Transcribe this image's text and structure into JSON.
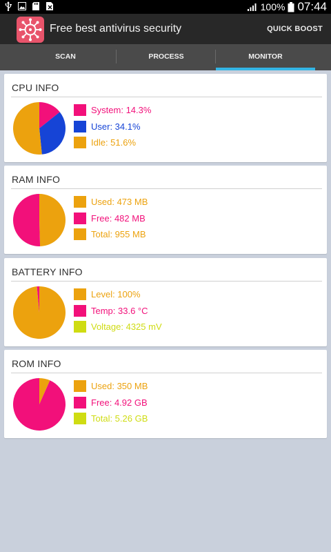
{
  "status_bar": {
    "battery": "100%",
    "time": "07:44",
    "left_icons": [
      "usb-icon",
      "image-icon",
      "sd-card-icon",
      "file-x-icon"
    ]
  },
  "header": {
    "app_title": "Free best antivirus security",
    "quick_boost": "QUICK BOOST"
  },
  "tabs": [
    {
      "label": "SCAN",
      "active": false
    },
    {
      "label": "PROCESS",
      "active": false
    },
    {
      "label": "MONITOR",
      "active": true
    }
  ],
  "colors": {
    "pink": "#f2107a",
    "blue": "#1644d6",
    "orange": "#eca20e",
    "lime": "#cfdc12",
    "tab_indicator": "#33b5e5"
  },
  "cards": [
    {
      "id": "cpu",
      "title": "CPU INFO",
      "items": [
        {
          "text": "System: 14.3%",
          "color": "#f2107a"
        },
        {
          "text": "User: 34.1%",
          "color": "#1644d6"
        },
        {
          "text": "Idle: 51.6%",
          "color": "#eca20e"
        }
      ],
      "pie": [
        {
          "value": 14.3,
          "color": "#f2107a"
        },
        {
          "value": 34.1,
          "color": "#1644d6"
        },
        {
          "value": 51.6,
          "color": "#eca20e"
        }
      ]
    },
    {
      "id": "ram",
      "title": "RAM INFO",
      "items": [
        {
          "text": "Used: 473 MB",
          "color": "#eca20e"
        },
        {
          "text": "Free: 482 MB",
          "color": "#f2107a"
        },
        {
          "text": "Total: 955 MB",
          "color": "#eca20e"
        }
      ],
      "pie": [
        {
          "value": 473,
          "color": "#eca20e"
        },
        {
          "value": 482,
          "color": "#f2107a"
        }
      ]
    },
    {
      "id": "battery",
      "title": "BATTERY INFO",
      "items": [
        {
          "text": "Level: 100%",
          "color": "#eca20e"
        },
        {
          "text": "Temp: 33.6 °C",
          "color": "#f2107a"
        },
        {
          "text": "Voltage: 4325 mV",
          "color": "#cfdc12"
        }
      ],
      "pie": [
        {
          "value": 100,
          "color": "#eca20e"
        },
        {
          "value": 1.5,
          "color": "#f2107a"
        }
      ]
    },
    {
      "id": "rom",
      "title": "ROM INFO",
      "items": [
        {
          "text": "Used: 350 MB",
          "color": "#eca20e"
        },
        {
          "text": "Free: 4.92 GB",
          "color": "#f2107a"
        },
        {
          "text": "Total: 5.26 GB",
          "color": "#cfdc12"
        }
      ],
      "pie": [
        {
          "value": 0.35,
          "color": "#eca20e"
        },
        {
          "value": 4.92,
          "color": "#f2107a"
        }
      ]
    }
  ]
}
